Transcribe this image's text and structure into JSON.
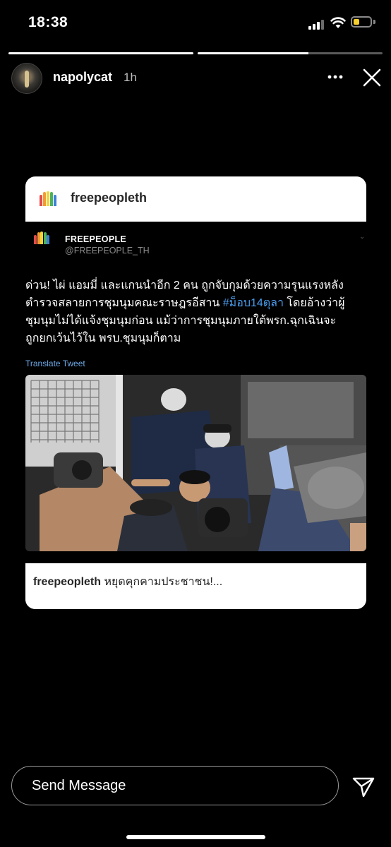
{
  "status_bar": {
    "time": "18:38",
    "icons": [
      "cellular-signal-icon",
      "wifi-icon",
      "battery-icon"
    ],
    "battery_level": 0.35,
    "battery_color": "#f6cf2e"
  },
  "story_progress": [
    {
      "segment": 1,
      "filled": 1.0
    },
    {
      "segment": 2,
      "filled": 0.6
    }
  ],
  "header": {
    "username": "napolycat",
    "time_ago": "1h",
    "more_icon": "more-horizontal-icon",
    "close_icon": "close-icon"
  },
  "shared_post": {
    "account": "freepeopleth",
    "logo_icon": "rainbow-bars-logo-icon",
    "tweet": {
      "display_name": "FREEPEOPLE",
      "handle": "@FREEPEOPLE_TH",
      "text_lines": [
        "ด่วน! ไผ่ แอมมี่ และแกนนำอีก 2 คน ถูกจับกุมด้วยความรุนแรงหลัง",
        "ตำรวจสลายการชุมนุมคณะราษฎรอีสาน ",
        "ชุมนุมไม่ได้แจ้งชุมนุมก่อน แม้ว่าการชุมนุมภายใต้พรก.ฉุกเฉินจะ",
        "ถูกยกเว้นไว้ใน พรบ.ชุมนุมก็ตาม"
      ],
      "hashtag": "#ม็อบ14ตุลา",
      "line2_after": " โดยอ้างว่าผู้",
      "translate_label": "Translate Tweet",
      "hashtag_color": "#4a9ef0",
      "media_description_icon": "photo-of-arrest-icon"
    },
    "caption_user": "freepeopleth",
    "caption_text": " หยุดคุกคามประชาชน!..."
  },
  "footer": {
    "message_placeholder": "Send Message",
    "send_icon": "send-paper-plane-icon"
  }
}
